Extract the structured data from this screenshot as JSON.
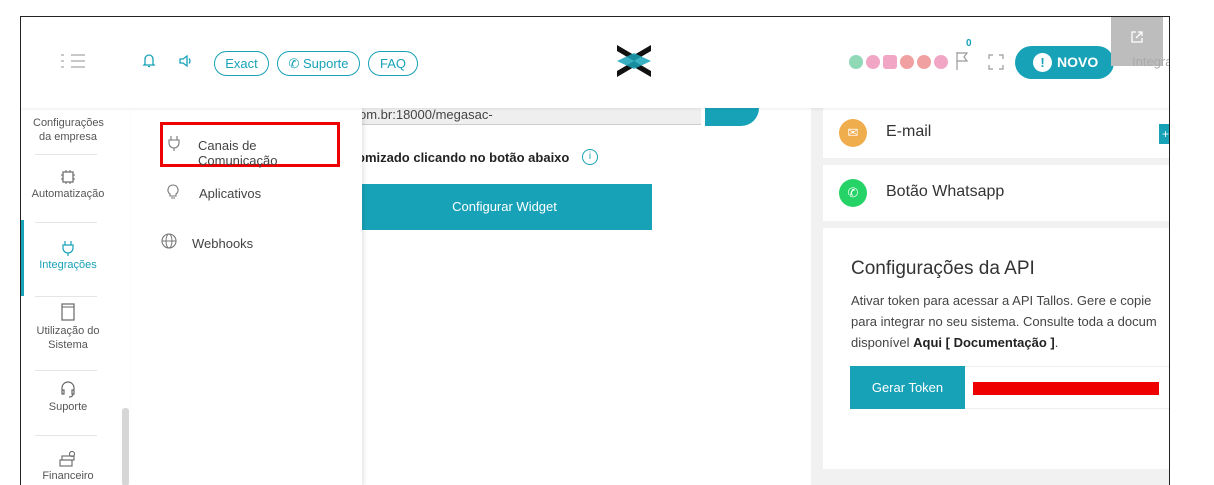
{
  "topbar": {
    "pill_exact": "Exact",
    "pill_suporte": "Suporte",
    "pill_faq": "FAQ",
    "notification_count": "0",
    "novo_label": "NOVO",
    "integra_text": "Integra"
  },
  "sidebar": {
    "items": [
      {
        "label": "Configurações da empresa",
        "icon": "building-icon"
      },
      {
        "label": "Automatização",
        "icon": "chip-icon"
      },
      {
        "label": "Integrações",
        "icon": "plug-icon"
      },
      {
        "label": "Utilização do Sistema",
        "icon": "document-icon"
      },
      {
        "label": "Suporte",
        "icon": "headset-icon"
      },
      {
        "label": "Financeiro",
        "icon": "money-icon"
      }
    ]
  },
  "dropdown": {
    "canais": "Canais de Comunicação",
    "aplicativos": "Aplicativos",
    "webhooks": "Webhooks"
  },
  "main": {
    "url_value": "om.br:18000/megasac-",
    "custom_text": "omizado clicando no botão abaixo",
    "widget_button": "Configurar Widget"
  },
  "right": {
    "email_label": "E-mail",
    "whatsapp_label": "Botão Whatsapp",
    "api_title": "Configurações da API",
    "api_desc_line1": "Ativar token para acessar a API Tallos. Gere e copie",
    "api_desc_line2": "para integrar no seu sistema. Consulte toda a docum",
    "api_desc_line3_prefix": "disponível ",
    "api_desc_link": "Aqui [ Documentação ]",
    "api_desc_suffix": ".",
    "token_button": "Gerar Token"
  },
  "colors": {
    "accent": "#17a2b8",
    "highlight": "#ee0000",
    "email": "#f0ad4e",
    "whatsapp": "#25d366"
  }
}
